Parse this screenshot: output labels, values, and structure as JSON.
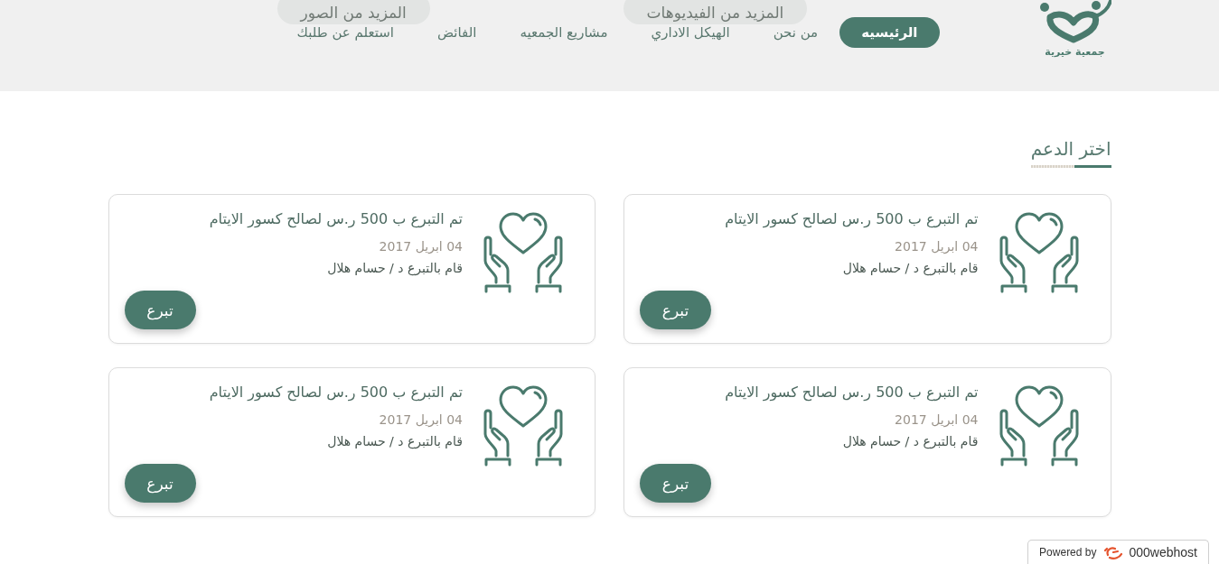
{
  "header": {
    "logo": {
      "text": "جمعية خيرية"
    },
    "nav": [
      {
        "label": "الرئيسيه",
        "selected": true
      },
      {
        "label": "من نحن",
        "selected": false
      },
      {
        "label": "الهيكل الاداري",
        "selected": false
      },
      {
        "label": "مشاريع الجمعيه",
        "selected": false
      },
      {
        "label": "الفائض",
        "selected": false
      },
      {
        "label": "استعلم عن طلبك",
        "selected": false
      }
    ],
    "overlay_buttons": [
      {
        "label": "المزيد من الفيديوهات"
      },
      {
        "label": "المزيد من الصور"
      }
    ]
  },
  "section": {
    "title": "اختر الدعم"
  },
  "cards": [
    {
      "title": "تم التبرع ب 500 ر.س لصالح كسور الايتام",
      "date": "04 ابريل 2017",
      "donor": "قام بالتبرع د / حسام هلال",
      "button": "تبرع"
    },
    {
      "title": "تم التبرع ب 500 ر.س لصالح كسور الايتام",
      "date": "04 ابريل 2017",
      "donor": "قام بالتبرع د / حسام هلال",
      "button": "تبرع"
    },
    {
      "title": "تم التبرع ب 500 ر.س لصالح كسور الايتام",
      "date": "04 ابريل 2017",
      "donor": "قام بالتبرع د / حسام هلال",
      "button": "تبرع"
    },
    {
      "title": "تم التبرع ب 500 ر.س لصالح كسور الايتام",
      "date": "04 ابريل 2017",
      "donor": "قام بالتبرع د / حسام هلال",
      "button": "تبرع"
    }
  ],
  "hosting_badge": {
    "prefix": "Powered by",
    "brand": "000webhost"
  }
}
